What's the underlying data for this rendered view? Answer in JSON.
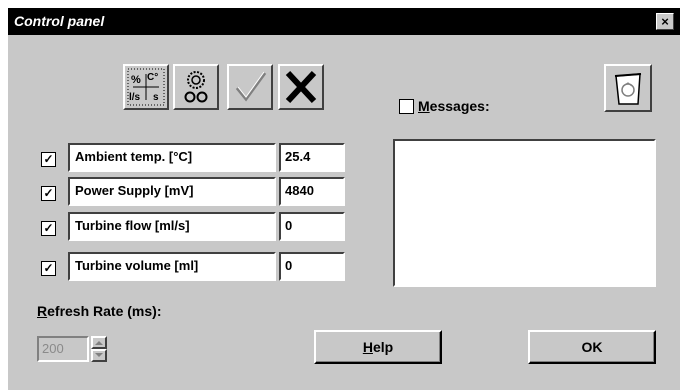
{
  "window": {
    "title": "Control panel",
    "close_glyph": "×"
  },
  "toolbar": {
    "units_icon": "units-icon",
    "settings_icon": "gears-icon",
    "check_icon": "checkmark-icon",
    "x_icon": "x-icon",
    "units_glyph_a": "%",
    "units_glyph_b": "C°",
    "units_glyph_c": "l/s",
    "units_glyph_d": "s"
  },
  "readings": [
    {
      "checked": true,
      "label": "Ambient temp. [°C]",
      "value": "25.4"
    },
    {
      "checked": true,
      "label": "Power Supply [mV]",
      "value": "4840"
    },
    {
      "checked": true,
      "label": "Turbine flow [ml/s]",
      "value": "0"
    },
    {
      "checked": true,
      "label": "Turbine volume [ml]",
      "value": "0"
    }
  ],
  "checkmark_glyph": "✓",
  "messages": {
    "label_first": "M",
    "label_rest": "essages:",
    "checked": false,
    "content": ""
  },
  "refresh": {
    "label_first": "R",
    "label_rest": "efresh Rate (ms):",
    "value": "200"
  },
  "buttons": {
    "help_first": "H",
    "help_rest": "elp",
    "ok_label": "OK"
  }
}
